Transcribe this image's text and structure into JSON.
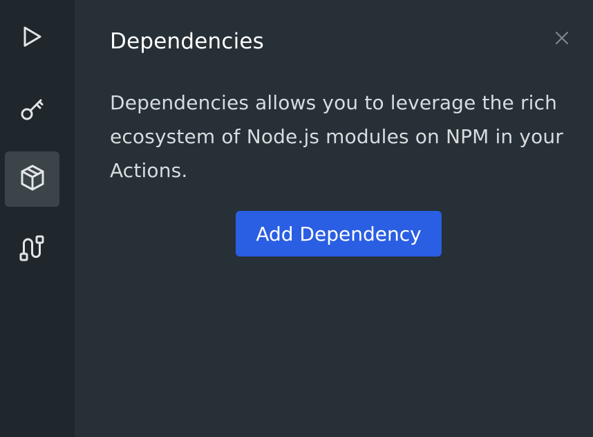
{
  "sidebar": {
    "items": [
      {
        "icon": "play-icon",
        "active": false
      },
      {
        "icon": "key-icon",
        "active": false
      },
      {
        "icon": "package-icon",
        "active": true
      },
      {
        "icon": "versions-icon",
        "active": false
      }
    ]
  },
  "panel": {
    "title": "Dependencies",
    "description": "Dependencies allows you to leverage the rich ecosystem of Node.js modules on NPM in your Actions.",
    "add_button_label": "Add Dependency",
    "close_icon": "close-icon"
  },
  "colors": {
    "sidebar_bg": "#1f272c",
    "panel_bg": "#263036",
    "active_item_bg": "#3a4449",
    "accent": "#2a5ee3",
    "text_primary": "#ffffff",
    "text_secondary": "#d8dcdf",
    "icon": "#e3e6e8"
  }
}
